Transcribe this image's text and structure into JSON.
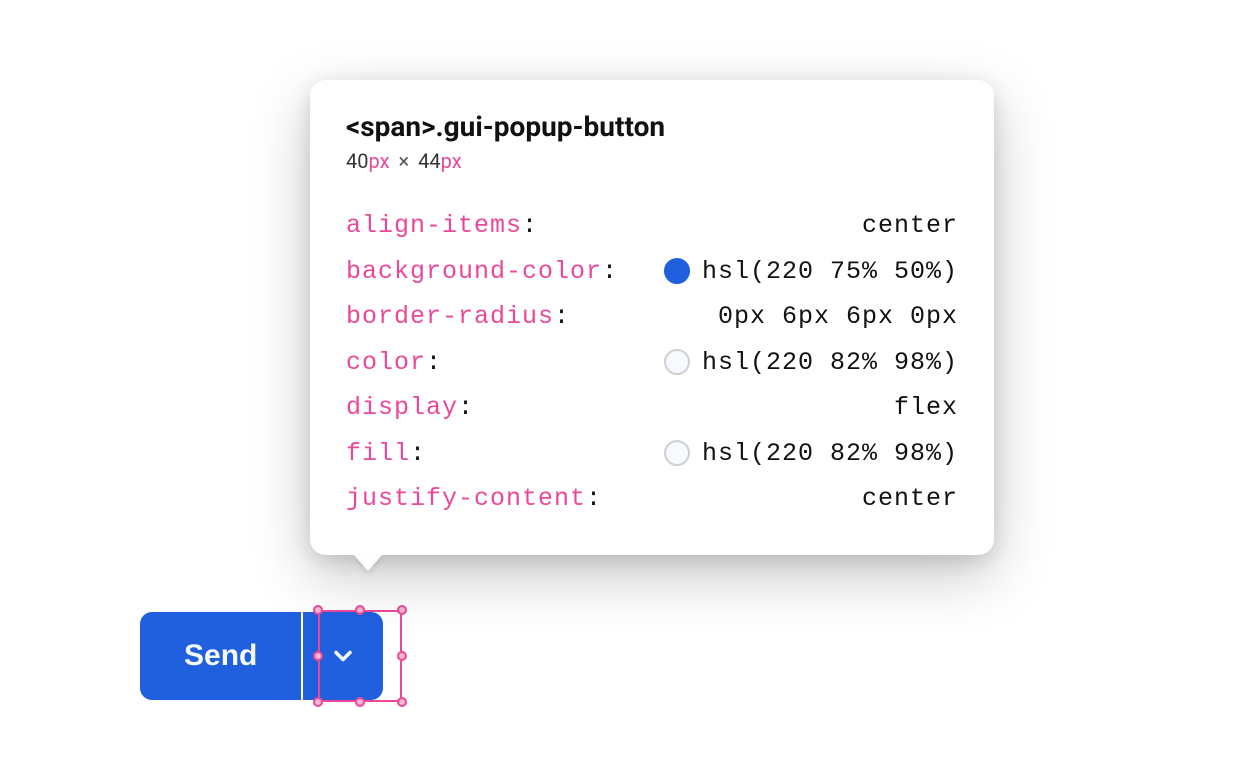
{
  "button": {
    "send_label": "Send"
  },
  "inspector": {
    "selector": "<span>.gui-popup-button",
    "dims": {
      "width_num": "40",
      "width_unit": "px",
      "times": "×",
      "height_num": "44",
      "height_unit": "px"
    },
    "props": [
      {
        "key": "align-items",
        "value": "center",
        "swatch": null
      },
      {
        "key": "background-color",
        "value": "hsl(220 75% 50%)",
        "swatch": "blue"
      },
      {
        "key": "border-radius",
        "value": "0px 6px 6px 0px",
        "swatch": null
      },
      {
        "key": "color",
        "value": "hsl(220 82% 98%)",
        "swatch": "white"
      },
      {
        "key": "display",
        "value": "flex",
        "swatch": null
      },
      {
        "key": "fill",
        "value": "hsl(220 82% 98%)",
        "swatch": "white"
      },
      {
        "key": "justify-content",
        "value": "center",
        "swatch": null
      }
    ]
  }
}
